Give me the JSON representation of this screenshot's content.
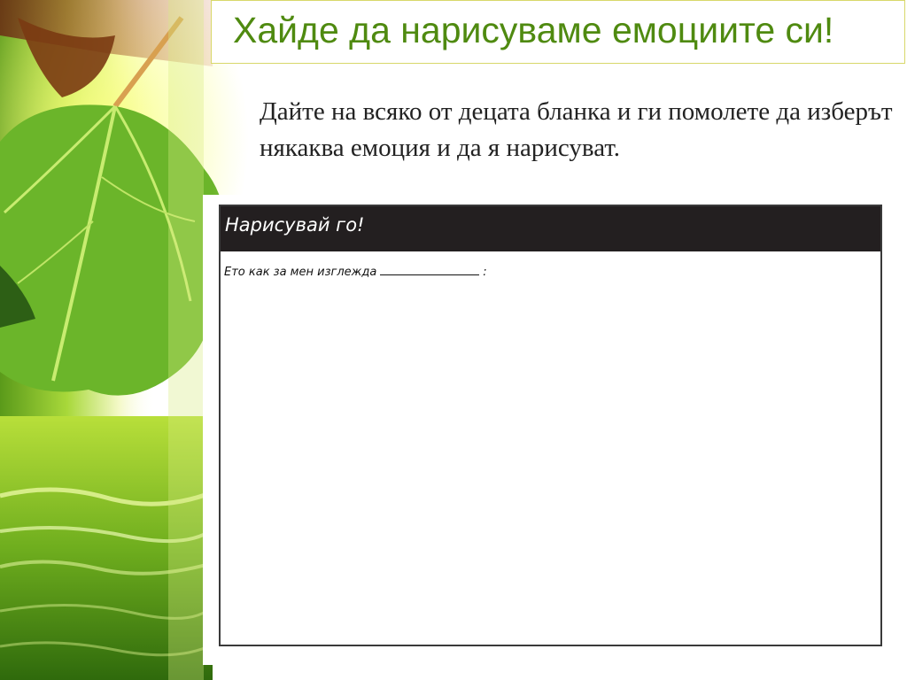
{
  "slide": {
    "title": "Хайде да нарисуваме емоциите си!",
    "body": "Дайте на всяко от децата бланка и ги помолете да изберът някаква емоция и да я нарисуват."
  },
  "worksheet": {
    "heading": "Нарисувай го!",
    "prompt": "Ето как за мен изглежда",
    "prompt_end": ":"
  },
  "colors": {
    "title": "#4f8a10",
    "header_bar": "#231f20",
    "leaf_green": "#6bb52a"
  }
}
